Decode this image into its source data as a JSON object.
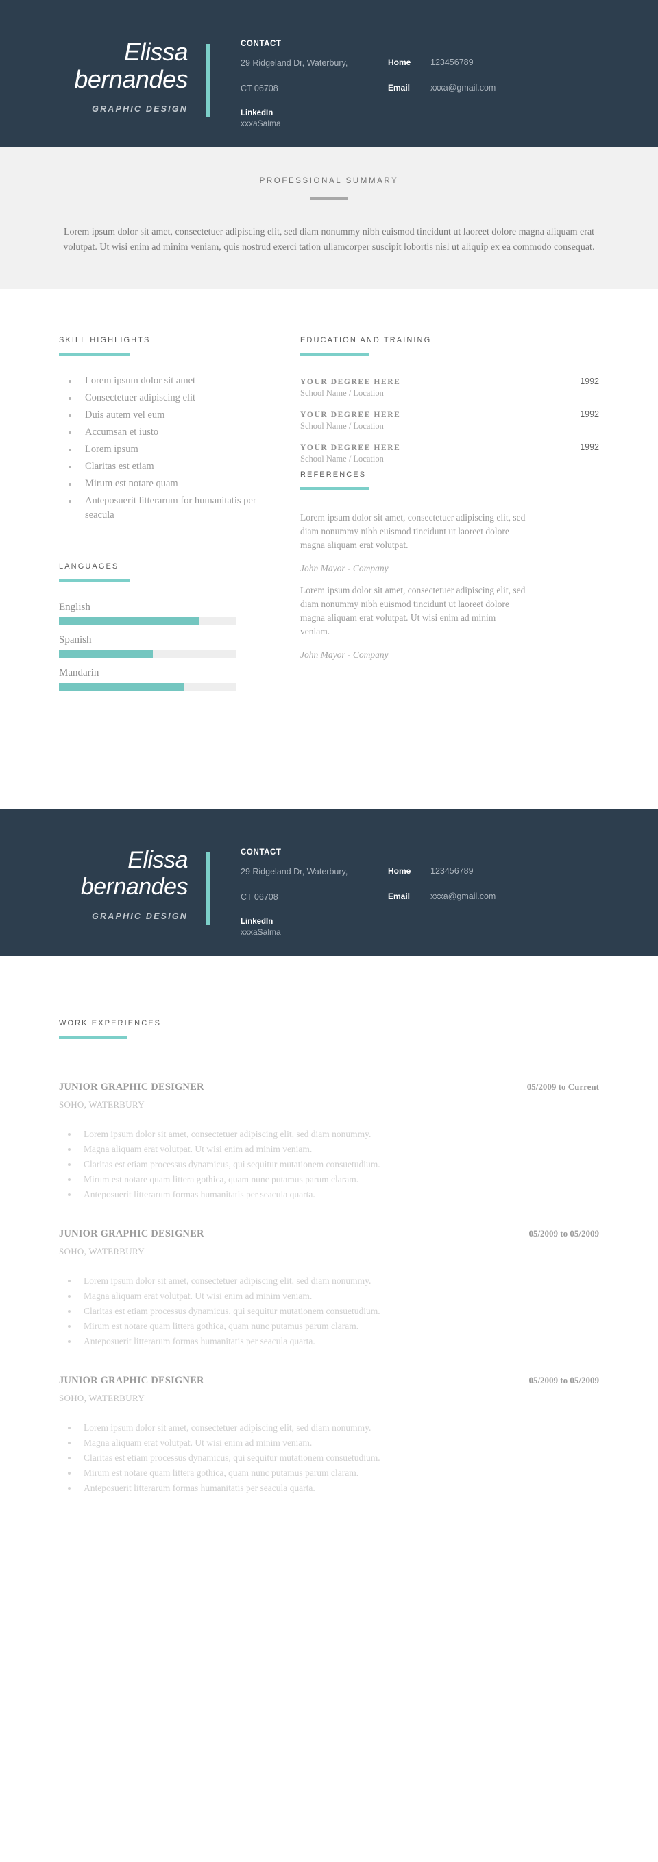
{
  "header": {
    "name": "Elissa\nbernandes",
    "role": "GRAPHIC DESIGN",
    "contact_title": "CONTACT",
    "address_line1": "29 Ridgeland Dr, Waterbury,",
    "address_line2": "CT 06708",
    "linkedin_label": "LinkedIn",
    "linkedin_value": "xxxaSalma",
    "home_label": "Home",
    "home_value": "123456789",
    "email_label": "Email",
    "email_value": "xxxa@gmail.com",
    "accent_color": "#7ccfc9",
    "background_color": "#2d3e4e"
  },
  "summary": {
    "heading": "PROFESSIONAL SUMMARY",
    "text": "Lorem ipsum dolor sit amet, consectetuer adipiscing elit, sed diam nonummy nibh euismod tincidunt ut laoreet dolore magna aliquam erat volutpat. Ut wisi enim ad minim veniam, quis nostrud exerci tation ullamcorper suscipit lobortis nisl ut aliquip ex ea commodo consequat."
  },
  "skills": {
    "heading": "SKILL HIGHLIGHTS",
    "items": [
      "Lorem ipsum dolor sit amet",
      "Consectetuer adipiscing elit",
      "Duis autem vel eum",
      "Accumsan et iusto",
      "Lorem ipsum",
      "Claritas est etiam",
      "Mirum est notare quam",
      "Anteposuerit litterarum for humanitatis per seacula"
    ]
  },
  "education": {
    "heading": "EDUCATION AND TRAINING",
    "items": [
      {
        "degree": "YOUR DEGREE HERE",
        "school": "School Name / Location",
        "year": "1992"
      },
      {
        "degree": "YOUR DEGREE HERE",
        "school": "School Name / Location",
        "year": "1992"
      },
      {
        "degree": "YOUR DEGREE HERE",
        "school": "School Name / Location",
        "year": "1992"
      }
    ]
  },
  "languages": {
    "heading": "LANGUAGES",
    "items": [
      {
        "name": "English",
        "level": 79
      },
      {
        "name": "Spanish",
        "level": 53
      },
      {
        "name": "Mandarin",
        "level": 71
      }
    ]
  },
  "references": {
    "heading": "REFERENCES",
    "items": [
      {
        "text": "Lorem ipsum dolor sit amet, consectetuer adipiscing elit, sed diam nonummy nibh euismod tincidunt ut laoreet dolore magna aliquam erat volutpat.",
        "author": "John Mayor - Company"
      },
      {
        "text": "Lorem ipsum dolor sit amet, consectetuer adipiscing elit, sed diam nonummy nibh euismod tincidunt ut laoreet dolore magna aliquam erat volutpat. Ut wisi enim ad minim veniam.",
        "author": "John Mayor - Company"
      }
    ]
  },
  "work": {
    "heading": "WORK EXPERIENCES",
    "jobs": [
      {
        "title": "JUNIOR GRAPHIC DESIGNER",
        "dates": "05/2009 to Current",
        "place": "SOHO, WATERBURY",
        "bullets": [
          "Lorem ipsum dolor sit amet, consectetuer adipiscing elit, sed diam nonummy.",
          "Magna aliquam erat volutpat. Ut wisi enim ad minim veniam.",
          "Claritas est etiam processus dynamicus, qui sequitur mutationem consuetudium.",
          "Mirum est notare quam littera gothica, quam nunc putamus parum claram.",
          "Anteposuerit litterarum formas humanitatis per seacula quarta."
        ]
      },
      {
        "title": "JUNIOR GRAPHIC DESIGNER",
        "dates": "05/2009 to 05/2009",
        "place": "SOHO, WATERBURY",
        "bullets": [
          "Lorem ipsum dolor sit amet, consectetuer adipiscing elit, sed diam nonummy.",
          "Magna aliquam erat volutpat. Ut wisi enim ad minim veniam.",
          "Claritas est etiam processus dynamicus, qui sequitur mutationem consuetudium.",
          "Mirum est notare quam littera gothica, quam nunc putamus parum claram.",
          "Anteposuerit litterarum formas humanitatis per seacula quarta."
        ]
      },
      {
        "title": "JUNIOR GRAPHIC DESIGNER",
        "dates": "05/2009 to 05/2009",
        "place": "SOHO, WATERBURY",
        "bullets": [
          "Lorem ipsum dolor sit amet, consectetuer adipiscing elit, sed diam nonummy.",
          "Magna aliquam erat volutpat. Ut wisi enim ad minim veniam.",
          "Claritas est etiam processus dynamicus, qui sequitur mutationem consuetudium.",
          "Mirum est notare quam littera gothica, quam nunc putamus parum claram.",
          "Anteposuerit litterarum formas humanitatis per seacula quarta."
        ]
      }
    ]
  }
}
